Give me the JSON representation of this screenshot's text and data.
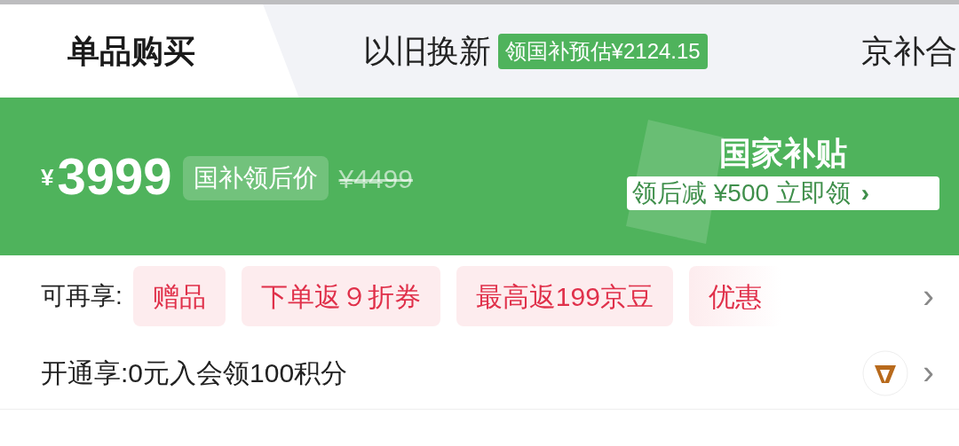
{
  "tabs": [
    {
      "label": "单品购买",
      "selected": true
    },
    {
      "label": "以旧换新",
      "selected": false,
      "badge": "领国补预估¥2124.15"
    },
    {
      "label": "京补合",
      "selected": false
    }
  ],
  "price_banner": {
    "currency": "¥",
    "price": "3999",
    "price_tag": "国补领后价",
    "original_price": "¥4499",
    "subsidy_title": "国家补贴",
    "subsidy_action": "领后减 ¥500 立即领",
    "subsidy_chevron": "›"
  },
  "benefits": {
    "label": "可再享:",
    "chips": [
      "赠品",
      "下单返９折券",
      "最高返199京豆",
      "优惠"
    ],
    "chevron": "›"
  },
  "membership": {
    "label": "开通享:0元入会领100积分",
    "chevron": "›"
  }
}
